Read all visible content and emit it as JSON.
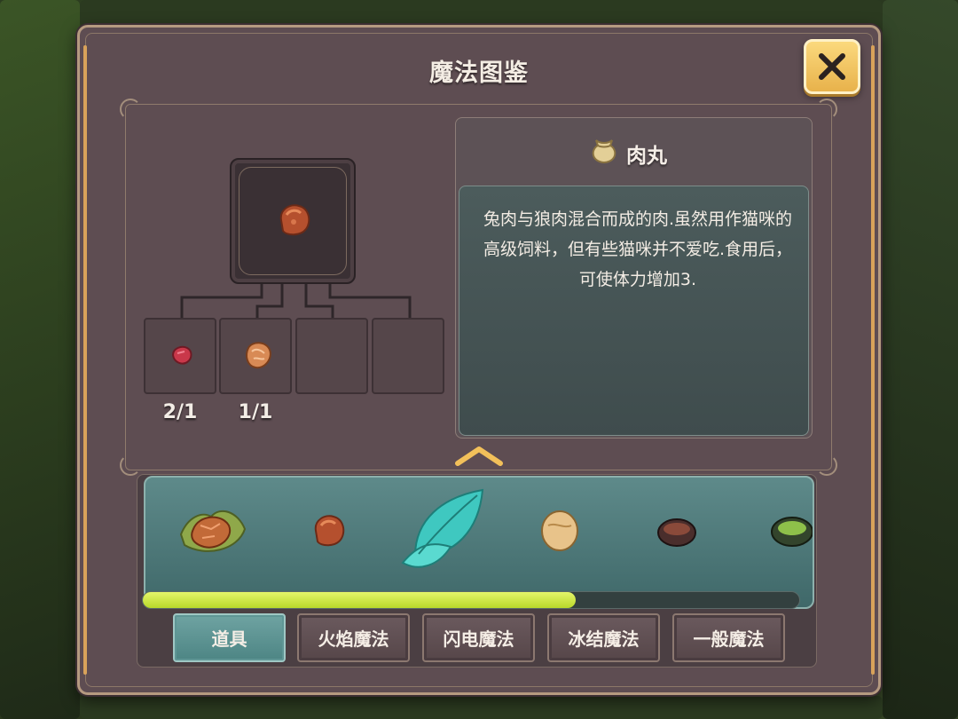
{
  "dialog": {
    "title": "魔法图鉴",
    "close_label": "关闭"
  },
  "selected_item": {
    "name": "肉丸",
    "icon": "pouch-icon",
    "description": "兔肉与狼肉混合而成的肉.虽然用作猫咪的高级饲料，但有些猫咪并不爱吃.食用后，可使体力增加3."
  },
  "recipe": {
    "result_icon": "meatball-icon",
    "ingredients": [
      {
        "icon": "rabbit-meat-icon",
        "count": "2/1"
      },
      {
        "icon": "wolf-meat-icon",
        "count": "1/1"
      },
      {
        "icon": "",
        "count": ""
      },
      {
        "icon": "",
        "count": ""
      }
    ]
  },
  "carousel": {
    "items": [
      {
        "name": "wrapped-meat-icon"
      },
      {
        "name": "meatball-icon"
      },
      {
        "name": "mint-leaf-icon"
      },
      {
        "name": "bread-icon"
      },
      {
        "name": "soup-bowl-icon"
      },
      {
        "name": "green-soup-bowl-icon"
      }
    ],
    "scroll_progress": 0.66
  },
  "tabs": [
    {
      "label": "道具",
      "active": true
    },
    {
      "label": "火焰魔法",
      "active": false
    },
    {
      "label": "闪电魔法",
      "active": false
    },
    {
      "label": "冰结魔法",
      "active": false
    },
    {
      "label": "一般魔法",
      "active": false
    }
  ],
  "colors": {
    "panel": "#5e4d52",
    "accent_gold": "#e8b24b",
    "active_tab": "#4d8584",
    "scroll_fill": "#c8e43a"
  }
}
